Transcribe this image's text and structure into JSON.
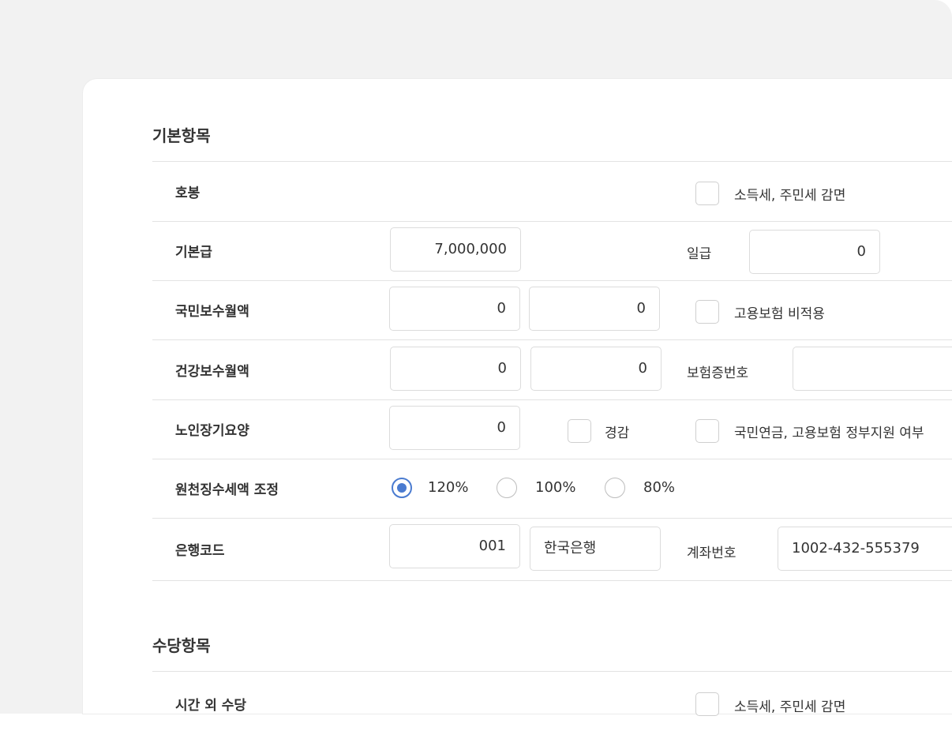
{
  "sections": {
    "basic": {
      "title": "기본항목"
    },
    "allowance": {
      "title": "수당항목"
    }
  },
  "rows": {
    "hobong": {
      "label": "호봉",
      "tax_exempt_checkbox": {
        "label": "소득세, 주민세 감면",
        "checked": false
      }
    },
    "base_salary": {
      "label": "기본급",
      "value": "7,000,000",
      "daily_label": "일급",
      "daily_value": "0"
    },
    "national_pension": {
      "label": "국민보수월액",
      "value1": "0",
      "value2": "0",
      "employment_insurance_checkbox": {
        "label": "고용보험 비적용",
        "checked": false
      }
    },
    "health": {
      "label": "건강보수월액",
      "value1": "0",
      "value2": "0",
      "insurance_no_label": "보험증번호",
      "insurance_no_value": ""
    },
    "longterm_care": {
      "label": "노인장기요양",
      "value": "0",
      "reduction_checkbox": {
        "label": "경감",
        "checked": false
      },
      "gov_support_checkbox": {
        "label": "국민연금, 고용보험 정부지원 여부",
        "checked": false
      }
    },
    "withholding": {
      "label": "원천징수세액 조정",
      "options": [
        {
          "label": "120%",
          "selected": true
        },
        {
          "label": "100%",
          "selected": false
        },
        {
          "label": "80%",
          "selected": false
        }
      ]
    },
    "bank": {
      "label": "은행코드",
      "code": "001",
      "name": "한국은행",
      "account_label": "계좌번호",
      "account_value": "1002-432-555379"
    },
    "overtime": {
      "label": "시간 외 수당",
      "tax_exempt_checkbox": {
        "label": "소득세, 주민세 감면",
        "checked": false
      }
    }
  },
  "colors": {
    "accent": "#4a7bd0",
    "backdrop": "#f2f2f2",
    "border": "#dcdcdc"
  }
}
